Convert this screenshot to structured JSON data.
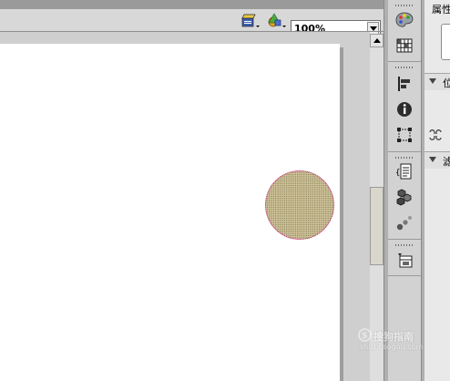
{
  "toolbar": {
    "zoom_value": "100%",
    "icons": [
      "edit-scene-icon",
      "edit-symbol-icon"
    ]
  },
  "icon_column": {
    "icons": [
      "color-palette-icon",
      "swatches-grid-icon",
      "align-icon",
      "info-icon",
      "transform-icon",
      "actions-code-icon",
      "components-icon",
      "behaviors-icon",
      "library-icon"
    ]
  },
  "properties_panel": {
    "title": "属性",
    "section_1_label": "位",
    "section_2_label": "滤"
  },
  "watermark": {
    "text": "搜狗指南",
    "url": "shizhi.sogou.com"
  },
  "colors": {
    "circle_fill": "#d0c39a",
    "circle_stroke": "#d21d8c",
    "stage": "#ffffff"
  }
}
